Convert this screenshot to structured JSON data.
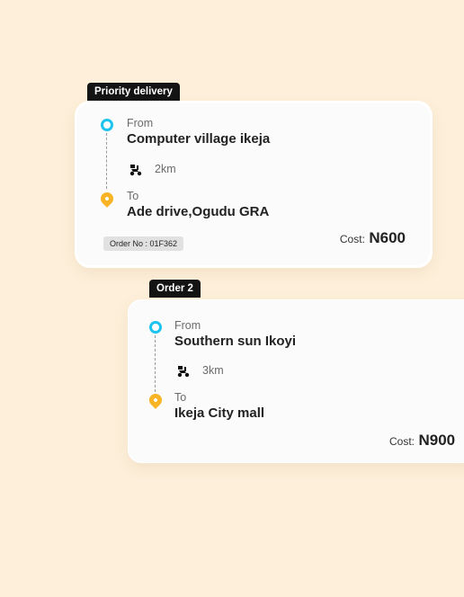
{
  "cards": [
    {
      "tag": "Priority delivery",
      "from_label": "From",
      "from_address": "Computer village ikeja",
      "distance": "2km",
      "to_label": "To",
      "to_address": "Ade drive,Ogudu GRA",
      "order_no": "Order  No : 01F362",
      "cost_label": "Cost:",
      "cost_value": "N600"
    },
    {
      "tag": "Order 2",
      "from_label": "From",
      "from_address": "Southern sun Ikoyi",
      "distance": "3km",
      "to_label": "To",
      "to_address": "Ikeja City mall",
      "cost_label": "Cost:",
      "cost_value": "N900"
    }
  ],
  "colors": {
    "background": "#fdefd9",
    "from_pin": "#1ec3ee",
    "to_pin": "#f8b425",
    "tag_bg": "#141414"
  },
  "icons": {
    "from": "pickup-pin-icon",
    "to": "dropoff-pin-icon",
    "vehicle": "delivery-bike-icon"
  }
}
